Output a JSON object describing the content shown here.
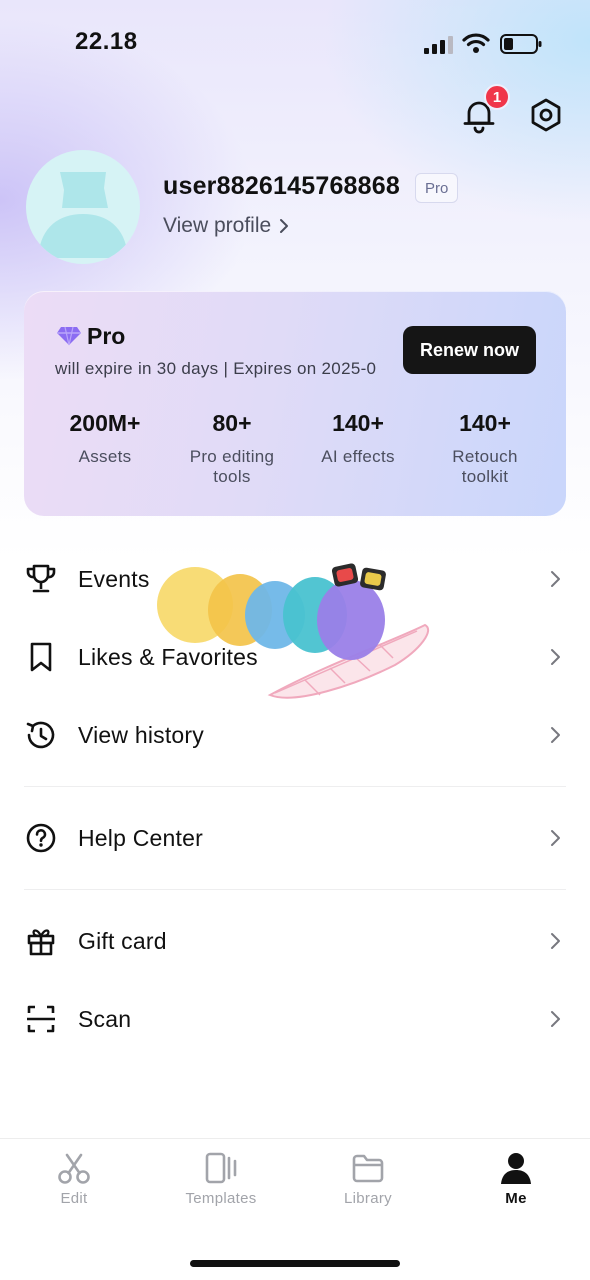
{
  "status_bar": {
    "time": "22.18"
  },
  "header": {
    "notification_count": "1"
  },
  "profile": {
    "username": "user8826145768868",
    "badge": "Pro",
    "view_profile_label": "View profile"
  },
  "pro_card": {
    "title": "Pro",
    "expire_text": "will expire in 30 days | Expires on 2025-0",
    "renew_label": "Renew now",
    "stats": [
      {
        "value": "200M+",
        "label": "Assets"
      },
      {
        "value": "80+",
        "label": "Pro editing tools"
      },
      {
        "value": "140+",
        "label": "AI effects"
      },
      {
        "value": "140+",
        "label": "Retouch toolkit"
      }
    ]
  },
  "menu": [
    {
      "label": "Events",
      "icon": "trophy-icon"
    },
    {
      "label": "Likes & Favorites",
      "icon": "bookmark-icon"
    },
    {
      "label": "View history",
      "icon": "history-icon"
    },
    {
      "label": "Help Center",
      "icon": "question-circle-icon"
    },
    {
      "label": "Gift card",
      "icon": "gift-icon"
    },
    {
      "label": "Scan",
      "icon": "scan-icon"
    }
  ],
  "tabs": [
    {
      "label": "Edit",
      "icon": "scissors-icon",
      "active": false
    },
    {
      "label": "Templates",
      "icon": "templates-icon",
      "active": false
    },
    {
      "label": "Library",
      "icon": "folder-icon",
      "active": false
    },
    {
      "label": "Me",
      "icon": "person-icon",
      "active": true
    }
  ],
  "colors": {
    "badge_red": "#f0364a",
    "renew_button": "#151515",
    "pro_gem": "#8b6cf2",
    "active_tab": "#111111",
    "inactive_tab": "#a2a4aa"
  }
}
